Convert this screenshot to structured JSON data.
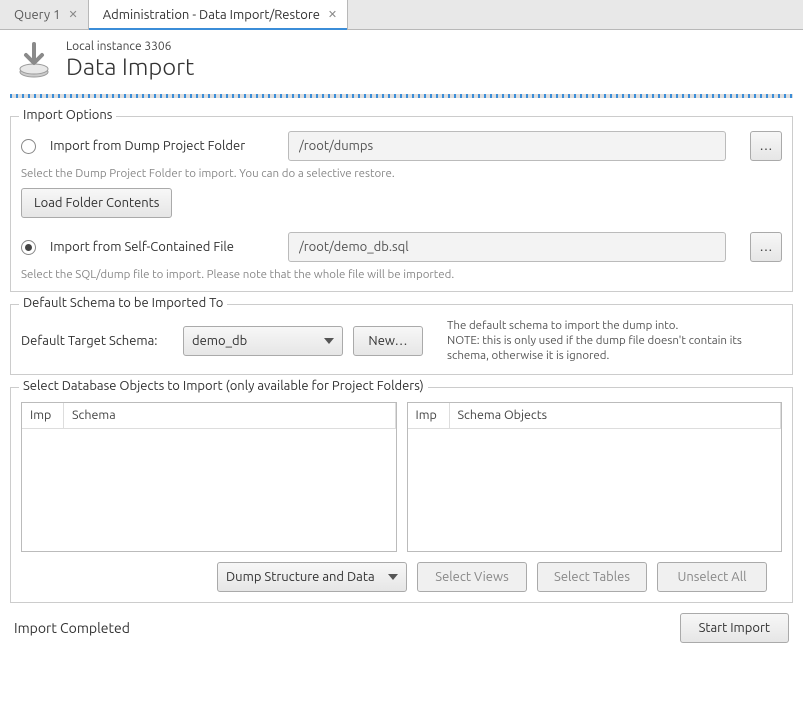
{
  "tabs": [
    {
      "label": "Query 1",
      "active": false
    },
    {
      "label": "Administration - Data Import/Restore",
      "active": true
    }
  ],
  "header": {
    "subtitle": "Local instance 3306",
    "title": "Data Import"
  },
  "importOptions": {
    "legend": "Import Options",
    "radioFolder": "Import from Dump Project Folder",
    "folderPath": "/root/dumps",
    "folderHint": "Select the Dump Project Folder to import. You can do a selective restore.",
    "loadFolderBtn": "Load Folder Contents",
    "radioFile": "Import from Self-Contained File",
    "filePath": "/root/demo_db.sql",
    "fileHint": "Select the SQL/dump file to import. Please note that the whole file will be imported.",
    "browseBtn": "…"
  },
  "schema": {
    "legend": "Default Schema to be Imported To",
    "label": "Default Target Schema:",
    "value": "demo_db",
    "newBtn": "New…",
    "note1": "The default schema to import the dump into.",
    "note2": "NOTE: this is only used if the dump file doesn't contain its schema, otherwise it is ignored."
  },
  "objects": {
    "legend": "Select Database Objects to Import (only available for Project Folders)",
    "col1a": "Imp",
    "col1b": "Schema",
    "col2a": "Imp",
    "col2b": "Schema Objects",
    "dumpMode": "Dump Structure and Data",
    "selectViews": "Select Views",
    "selectTables": "Select Tables",
    "unselectAll": "Unselect All"
  },
  "footer": {
    "status": "Import Completed",
    "startBtn": "Start Import"
  }
}
